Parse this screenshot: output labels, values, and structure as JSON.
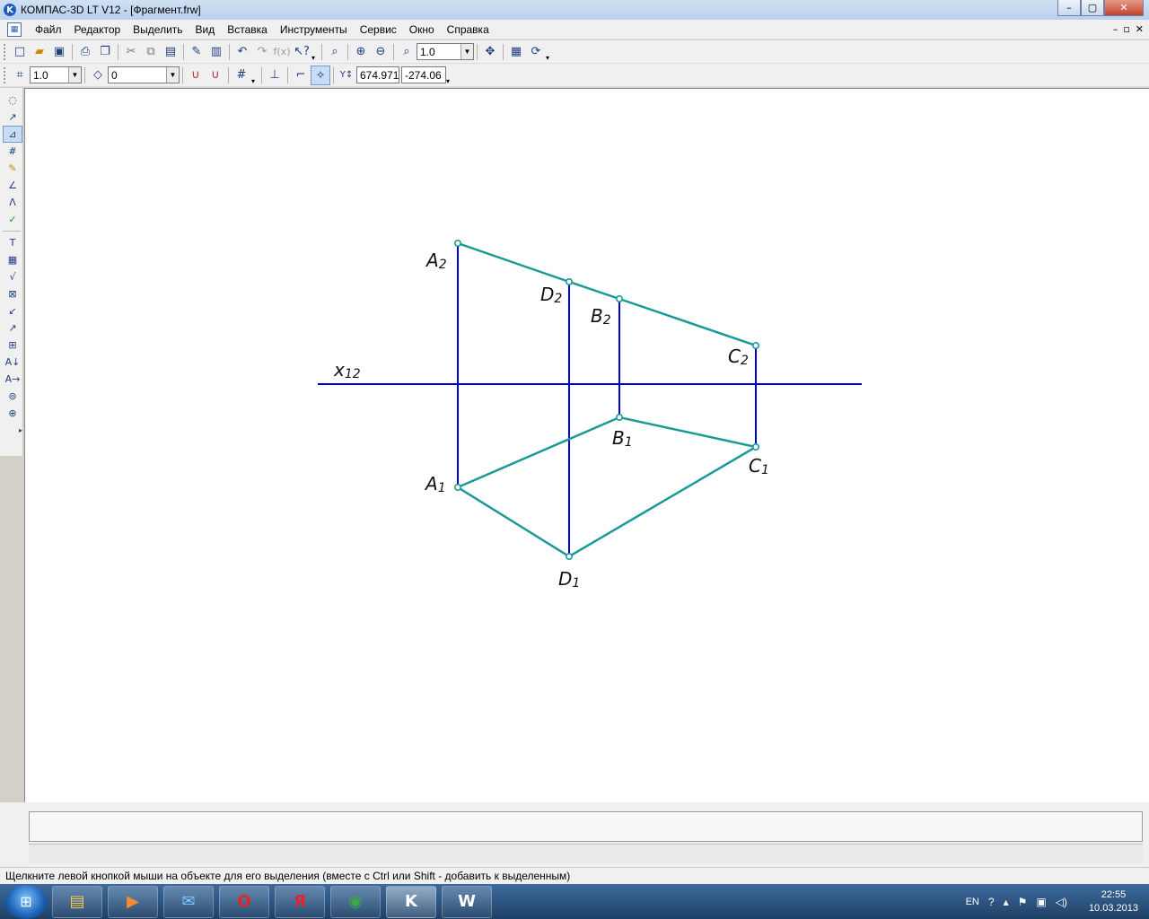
{
  "window": {
    "title": "КОМПАС-3D LT V12 - [Фрагмент.frw]",
    "controls": {
      "minimize": "–",
      "maximize": "▢",
      "close": "✕"
    }
  },
  "menu": {
    "items": [
      "Файл",
      "Редактор",
      "Выделить",
      "Вид",
      "Вставка",
      "Инструменты",
      "Сервис",
      "Окно",
      "Справка"
    ],
    "mdi_controls": {
      "minimize": "–",
      "restore": "▫",
      "close": "✕"
    }
  },
  "toolbar_standard": {
    "zoom_value": "1.0"
  },
  "toolbar_current_state": {
    "step_value": "1.0",
    "layer_value": "0",
    "x_coordinate": "674.971",
    "y_coordinate": "-274.06"
  },
  "drawing": {
    "axis_label": {
      "main": "x",
      "sub": "12"
    },
    "points": [
      {
        "main": "A",
        "sub": "2"
      },
      {
        "main": "D",
        "sub": "2"
      },
      {
        "main": "B",
        "sub": "2"
      },
      {
        "main": "C",
        "sub": "2"
      },
      {
        "main": "A",
        "sub": "1"
      },
      {
        "main": "B",
        "sub": "1"
      },
      {
        "main": "C",
        "sub": "1"
      },
      {
        "main": "D",
        "sub": "1"
      }
    ],
    "colors": {
      "projection_line": "#0000cc",
      "figure_line": "#1a9a96"
    }
  },
  "status_bar": {
    "hint": "Щелкните левой кнопкой мыши на объекте для его выделения (вместе с Ctrl или Shift - добавить к выделенным)"
  },
  "taskbar": {
    "apps": [
      {
        "name": "explorer-icon",
        "glyph": "▤",
        "color": "#f2c94c"
      },
      {
        "name": "media-player-icon",
        "glyph": "▶",
        "color": "#ff8a2a"
      },
      {
        "name": "mail-icon",
        "glyph": "✉",
        "color": "#7fc4ff"
      },
      {
        "name": "opera-icon",
        "glyph": "O",
        "color": "#e0262a"
      },
      {
        "name": "yandex-icon",
        "glyph": "Я",
        "color": "#e0262a"
      },
      {
        "name": "chrome-icon",
        "glyph": "◉",
        "color": "#39a845"
      },
      {
        "name": "kompas-icon",
        "glyph": "K",
        "color": "#ffffff"
      },
      {
        "name": "word-icon",
        "glyph": "W",
        "color": "#ffffff"
      }
    ],
    "language": "EN",
    "time": "22:55",
    "date": "10.03.2013"
  }
}
